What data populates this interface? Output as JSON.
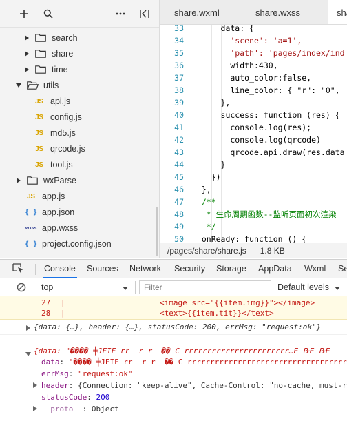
{
  "sidebar": {
    "items": [
      {
        "label": "search",
        "type": "folder",
        "state": "collapsed"
      },
      {
        "label": "share",
        "type": "folder",
        "state": "collapsed"
      },
      {
        "label": "time",
        "type": "folder",
        "state": "collapsed"
      },
      {
        "label": "utils",
        "type": "folder",
        "state": "expanded"
      },
      {
        "label": "api.js",
        "type": "js"
      },
      {
        "label": "config.js",
        "type": "js"
      },
      {
        "label": "md5.js",
        "type": "js"
      },
      {
        "label": "qrcode.js",
        "type": "js"
      },
      {
        "label": "tool.js",
        "type": "js"
      },
      {
        "label": "wxParse",
        "type": "folder",
        "state": "collapsed"
      },
      {
        "label": "app.js",
        "type": "js"
      },
      {
        "label": "app.json",
        "type": "json"
      },
      {
        "label": "app.wxss",
        "type": "wxss"
      },
      {
        "label": "project.config.json",
        "type": "json"
      }
    ],
    "badges": {
      "js": "JS",
      "json": "{ }",
      "wxss": "wxss"
    }
  },
  "editor": {
    "tabs": [
      "share.wxml",
      "share.wxss",
      "share"
    ],
    "active_tab": 2,
    "lines": [
      {
        "n": "33",
        "text": "      data: {"
      },
      {
        "n": "34",
        "text": "        'scene': 'a=1',"
      },
      {
        "n": "35",
        "text": "        'path': 'pages/index/ind"
      },
      {
        "n": "36",
        "text": "        width:430,"
      },
      {
        "n": "37",
        "text": "        auto_color:false,"
      },
      {
        "n": "38",
        "text": "        line_color: { \"r\": \"0\","
      },
      {
        "n": "39",
        "text": "      },"
      },
      {
        "n": "40",
        "text": "      success: function (res) {"
      },
      {
        "n": "41",
        "text": "        console.log(res);"
      },
      {
        "n": "42",
        "text": "        console.log(qrcode)"
      },
      {
        "n": "43",
        "text": "        qrcode.api.draw(res.data"
      },
      {
        "n": "44",
        "text": "      }"
      },
      {
        "n": "45",
        "text": "    })"
      },
      {
        "n": "46",
        "text": "  },"
      },
      {
        "n": "47",
        "text": "  /**"
      },
      {
        "n": "48",
        "text": "   * 生命周期函数--监听页面初次渲染"
      },
      {
        "n": "49",
        "text": "   */"
      },
      {
        "n": "50",
        "text": "  onReady: function () {"
      }
    ],
    "status": {
      "path": "/pages/share/share.js",
      "size": "1.8 KB"
    }
  },
  "devtools": {
    "tabs": [
      "Console",
      "Sources",
      "Network",
      "Security",
      "Storage",
      "AppData",
      "Wxml",
      "Se"
    ],
    "active_tab": "Console",
    "context": "top",
    "filter_placeholder": "Filter",
    "levels": "Default levels",
    "accent": "#1a73e8"
  },
  "console": {
    "src_lines": [
      {
        "n": "27",
        "text": "<image src=\"{{item.img}}\"></image>"
      },
      {
        "n": "28",
        "text": "<text>{{item.tit}}</text>"
      }
    ],
    "log1": "{data: {…}, header: {…}, statusCode: 200, errMsg: \"request:ok\"}",
    "log2_head": "{data: \"���� ╪JFIF rr  r r  �� C rrrrrrrrrrrrrrrrrrrrrrr…E ℞E ℞E",
    "fields": {
      "data": "\"���� ╪JFIF rr  r r  �� C rrrrrrrrrrrrrrrrrrrrrrrrrrrrrrrrrrrr",
      "errMsg": "\"request:ok\"",
      "header": "{Connection: \"keep-alive\", Cache-Control: \"no-cache, must-re",
      "statusCode": "200",
      "proto": "Object"
    },
    "keys": {
      "data": "data",
      "errMsg": "errMsg",
      "header": "header",
      "statusCode": "statusCode",
      "proto": "__proto__"
    }
  }
}
